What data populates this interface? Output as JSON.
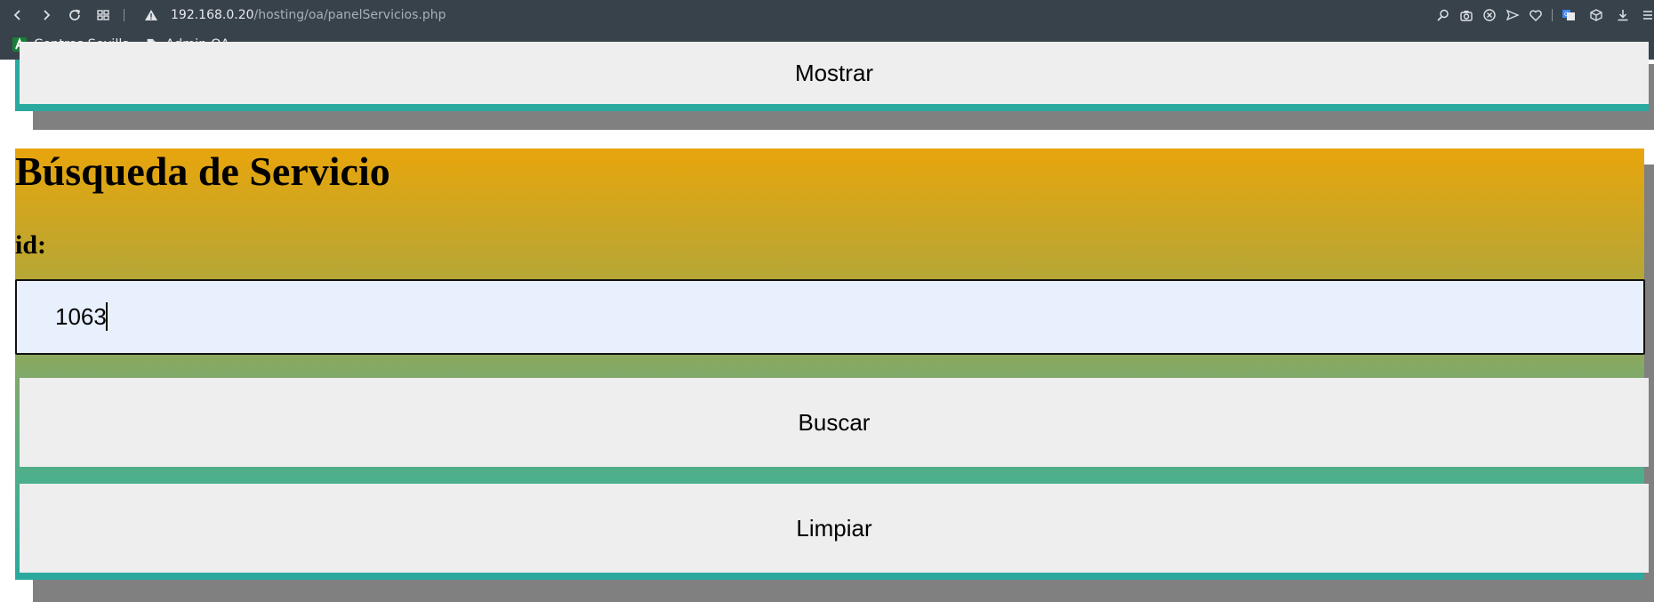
{
  "browser": {
    "url_host": "192.168.0.20",
    "url_path": "/hosting/oa/panelServicios.php",
    "bookmarks": [
      {
        "label": "Centros Sevilla",
        "icon": "android-a-icon"
      },
      {
        "label": "Admin OA",
        "icon": "document-icon"
      }
    ]
  },
  "top_panel": {
    "mostrar_label": "Mostrar"
  },
  "search_panel": {
    "title": "Búsqueda de Servicio",
    "id_label": "id:",
    "id_value": "1063",
    "search_button": "Buscar",
    "clear_button": "Limpiar"
  },
  "colors": {
    "chrome_bg": "#38424b",
    "button_bg": "#eeeeee",
    "frame_teal": "#2aa99f",
    "shadow_gray": "#808080",
    "gradient_top": "#e8a50c",
    "input_bg": "#e8f0fe"
  }
}
